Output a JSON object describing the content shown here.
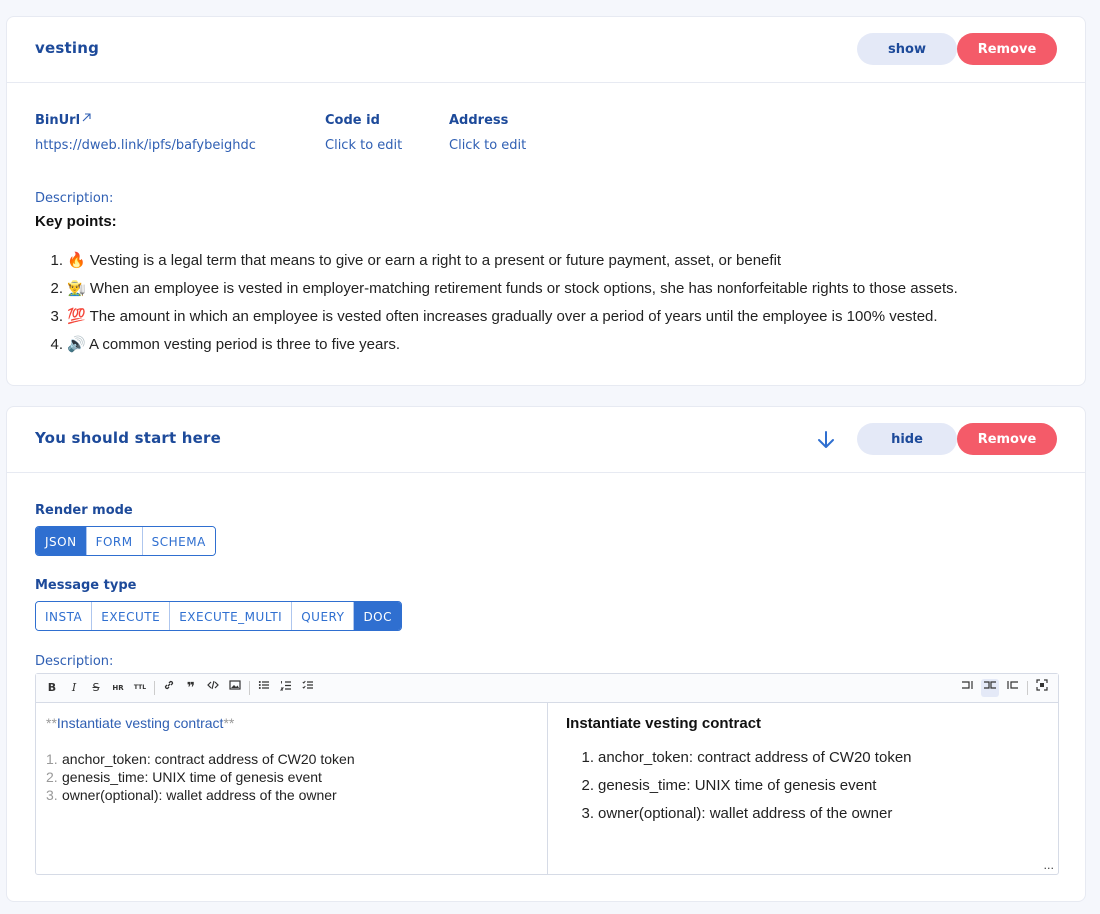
{
  "card1": {
    "title": "vesting",
    "show_label": "show",
    "remove_label": "Remove",
    "binurl_label": "BinUrl",
    "binurl_value": "https://dweb.link/ipfs/bafybeighdc",
    "codeid_label": "Code id",
    "codeid_value": "Click to edit",
    "address_label": "Address",
    "address_value": "Click to edit",
    "description_label": "Description:",
    "heading": "Key points:",
    "points": [
      {
        "num": "1.",
        "emoji": "🔥",
        "text": "Vesting is a legal term that means to give or earn a right to a present or future payment, asset, or benefit"
      },
      {
        "num": "2.",
        "emoji": "👨‍🌾",
        "text": "When an employee is vested in employer-matching retirement funds or stock options, she has nonforfeitable rights to those assets."
      },
      {
        "num": "3.",
        "emoji": "💯",
        "text": "The amount in which an employee is vested often increases gradually over a period of years until the employee is 100% vested."
      },
      {
        "num": "4.",
        "emoji": "🔊",
        "text": "A common vesting period is three to five years."
      }
    ]
  },
  "card2": {
    "title": "You should start here",
    "hide_label": "hide",
    "remove_label": "Remove",
    "render_mode_label": "Render mode",
    "render_modes": [
      "JSON",
      "FORM",
      "SCHEMA"
    ],
    "render_mode_selected": "JSON",
    "message_type_label": "Message type",
    "message_types": [
      "INSTA",
      "EXECUTE",
      "EXECUTE_MULTI",
      "QUERY",
      "DOC"
    ],
    "message_type_selected": "DOC",
    "description_label": "Description:",
    "source": {
      "bold_marker": "**",
      "heading": "Instantiate vesting contract",
      "items": [
        {
          "num": "1.",
          "text": "anchor_token: contract address of CW20 token"
        },
        {
          "num": "2.",
          "text": "genesis_time: UNIX time of genesis event"
        },
        {
          "num": "3.",
          "text": "owner(optional): wallet address of the owner"
        }
      ]
    },
    "preview": {
      "heading": "Instantiate vesting contract",
      "items": [
        {
          "num": "1.",
          "text": "anchor_token: contract address of CW20 token"
        },
        {
          "num": "2.",
          "text": "genesis_time: UNIX time of genesis event"
        },
        {
          "num": "3.",
          "text": "owner(optional): wallet address of the owner"
        }
      ]
    },
    "toolbar": {
      "bold": "B",
      "italic": "I",
      "strike": "S",
      "hr": "HR",
      "title": "TTL",
      "resize_dots": "..."
    }
  }
}
